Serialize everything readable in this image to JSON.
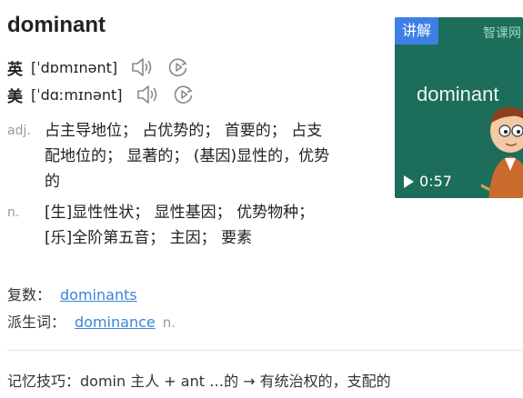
{
  "entry": {
    "word": "dominant",
    "pronunciations": [
      {
        "label": "英",
        "ipa": "[ˈdɒmɪnənt]"
      },
      {
        "label": "美",
        "ipa": "[ˈdɑːmɪnənt]"
      }
    ],
    "definitions": [
      {
        "pos": "adj.",
        "lines": [
          "占主导地位；  占优势的；  首要的；  占支",
          "配地位的；  显著的；  (基因)显性的，优势",
          "的"
        ]
      },
      {
        "pos": "n.",
        "lines": [
          "[生]显性性状；  显性基因；  优势物种；",
          "[乐]全阶第五音；  主因；  要素"
        ]
      }
    ],
    "forms": [
      {
        "label": "复数：",
        "value": "dominants",
        "pos": ""
      },
      {
        "label": "派生词：",
        "value": "dominance",
        "pos": "n."
      }
    ],
    "memory": "记忆技巧：domin 主人 + ant …的 → 有统治权的，支配的"
  },
  "video": {
    "tag": "讲解",
    "brand": "智课网",
    "word": "dominant",
    "duration": "0:57"
  },
  "icons": {
    "speaker": "speaker-icon",
    "replay": "replay-icon",
    "play": "play-icon"
  },
  "colors": {
    "link": "#3a84d8",
    "video_bg": "#1c6d5a",
    "tag_bg": "#3d7fe6"
  }
}
